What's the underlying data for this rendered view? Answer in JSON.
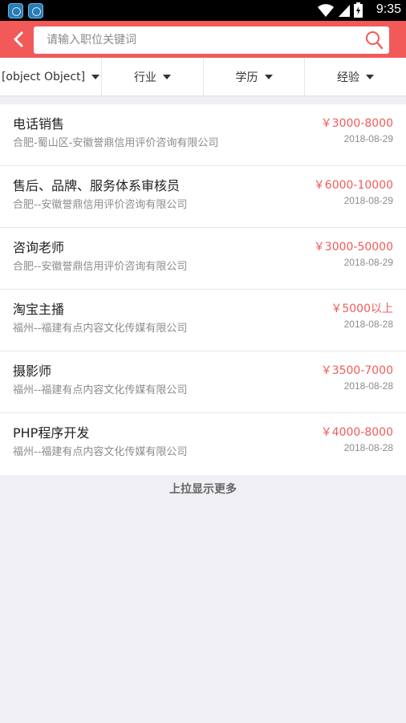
{
  "status_bar": {
    "time": "9:35",
    "left_icons": [
      "app-notification-icon",
      "app-notification-icon"
    ],
    "right_icons": [
      "wifi-icon",
      "signal-icon",
      "battery-icon"
    ]
  },
  "header": {
    "back_icon": "chevron-left-icon",
    "search_placeholder": "请输入职位关键词",
    "search_icon": "search-icon",
    "accent_color": "#f25a5a"
  },
  "filters": [
    {
      "label": "[object Object]"
    },
    {
      "label": "行业"
    },
    {
      "label": "学历"
    },
    {
      "label": "经验"
    }
  ],
  "jobs": [
    {
      "title": "电话销售",
      "company": "合肥-蜀山区-安徽誉鼎信用评价咨询有限公司",
      "salary": "￥3000-8000",
      "date": "2018-08-29"
    },
    {
      "title": "售后、品牌、服务体系审核员",
      "company": "合肥--安徽誉鼎信用评价咨询有限公司",
      "salary": "￥6000-10000",
      "date": "2018-08-29"
    },
    {
      "title": "咨询老师",
      "company": "合肥--安徽誉鼎信用评价咨询有限公司",
      "salary": "￥3000-50000",
      "date": "2018-08-29"
    },
    {
      "title": "淘宝主播",
      "company": "福州--福建有点内容文化传媒有限公司",
      "salary": "￥5000以上",
      "date": "2018-08-28"
    },
    {
      "title": "摄影师",
      "company": "福州--福建有点内容文化传媒有限公司",
      "salary": "￥3500-7000",
      "date": "2018-08-28"
    },
    {
      "title": "PHP程序开发",
      "company": "福州--福建有点内容文化传媒有限公司",
      "salary": "￥4000-8000",
      "date": "2018-08-28"
    }
  ],
  "load_more": "上拉显示更多"
}
